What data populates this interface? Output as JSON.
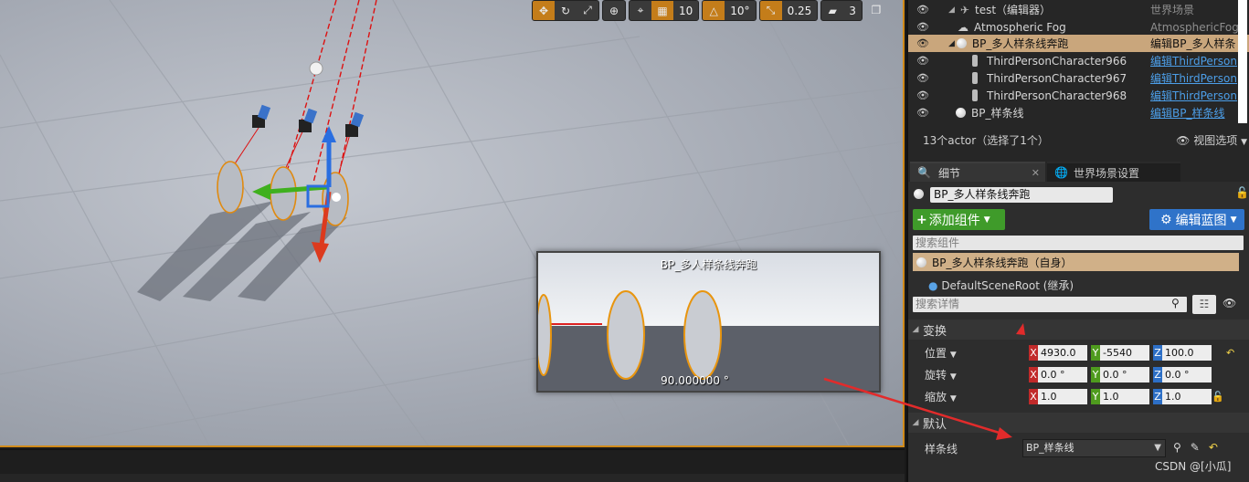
{
  "viewport": {
    "toolbar": {
      "grid_snap": "10",
      "rotation_snap": "10°",
      "scale_snap": "0.25",
      "camera_speed": "3"
    },
    "preview": {
      "title": "BP_多人样条线奔跑",
      "angle": "90.000000 °"
    }
  },
  "outliner": {
    "rows": [
      {
        "name": "test（编辑器）",
        "type": "世界场景",
        "link": false
      },
      {
        "name": "Atmospheric Fog",
        "type": "AtmosphericFog",
        "link": false
      },
      {
        "name": "BP_多人样条线奔跑",
        "type": "编辑BP_多人样条",
        "link": false
      },
      {
        "name": "ThirdPersonCharacter966",
        "type": "编辑ThirdPerson",
        "link": true
      },
      {
        "name": "ThirdPersonCharacter967",
        "type": "编辑ThirdPerson",
        "link": true
      },
      {
        "name": "ThirdPersonCharacter968",
        "type": "编辑ThirdPerson",
        "link": true
      },
      {
        "name": "BP_样条线",
        "type": "编辑BP_样条线",
        "link": true
      }
    ],
    "count": "13个actor（选择了1个）",
    "view_options": "视图选项"
  },
  "tabs": {
    "details": "细节",
    "world_settings": "世界场景设置"
  },
  "details": {
    "actor_name": "BP_多人样条线奔跑",
    "add_component": "添加组件",
    "edit_blueprint": "编辑蓝图",
    "search_components": "搜索组件",
    "component_self": "BP_多人样条线奔跑（自身）",
    "component_root": "DefaultSceneRoot (继承)",
    "search_details": "搜索详情",
    "transform": {
      "category": "变换",
      "location_label": "位置",
      "location": [
        "4930.0",
        "-5540",
        "100.0"
      ],
      "rotation_label": "旋转",
      "rotation": [
        "0.0 °",
        "0.0 °",
        "0.0 °"
      ],
      "scale_label": "缩放",
      "scale": [
        "1.0",
        "1.0",
        "1.0"
      ]
    },
    "default": {
      "category": "默认",
      "spline_label": "样条线",
      "spline_value": "BP_样条线"
    }
  },
  "watermark": "CSDN @[小瓜]"
}
